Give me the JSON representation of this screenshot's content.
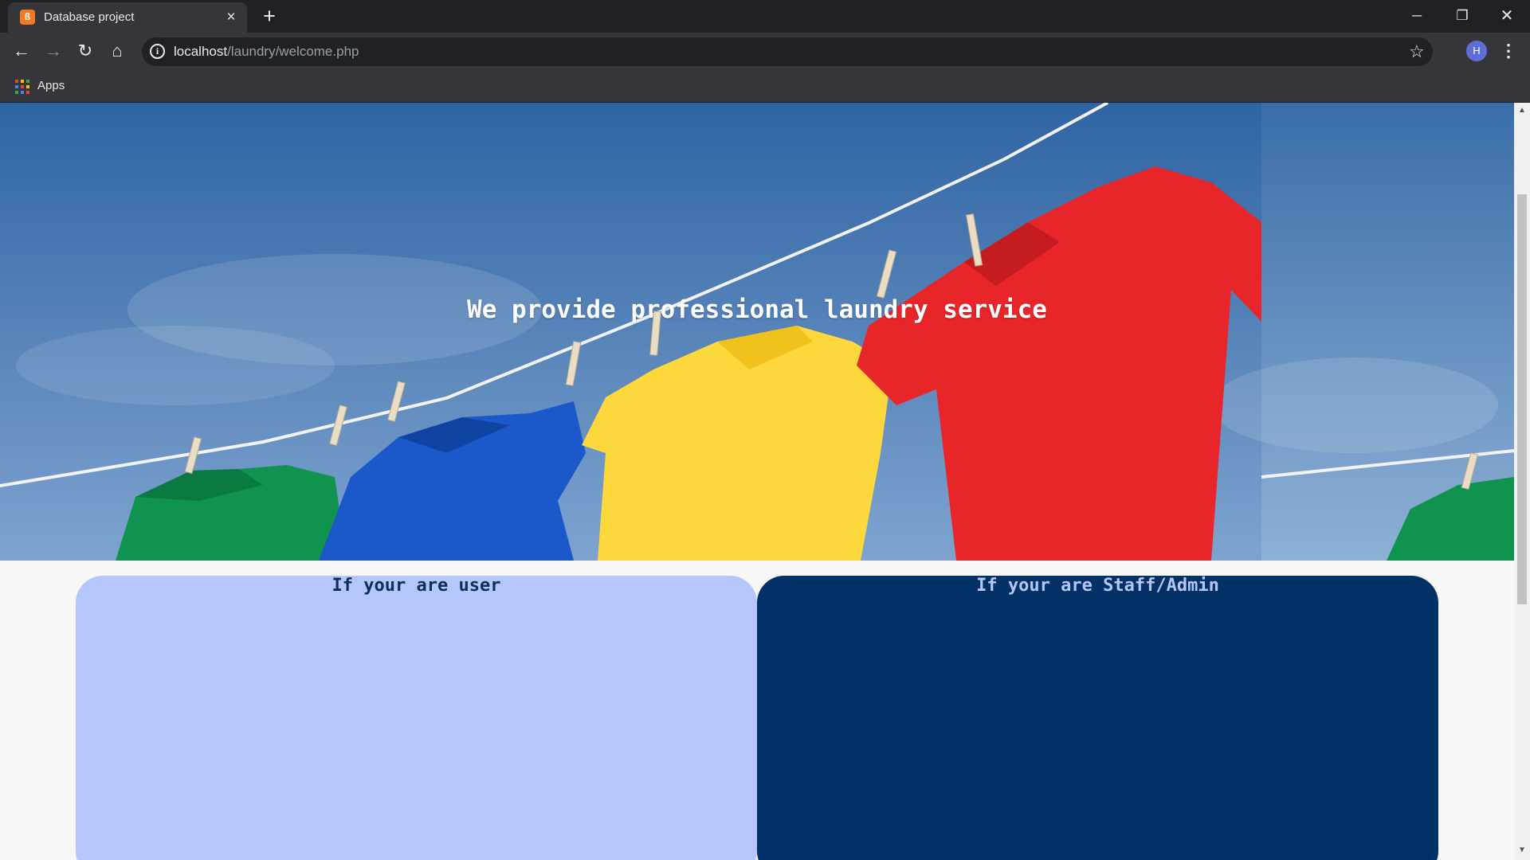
{
  "browser": {
    "tab": {
      "title": "Database project",
      "favicon": "xampp-logo-icon",
      "close": "×"
    },
    "new_tab": "+",
    "window": {
      "minimize": "─",
      "maximize": "❐",
      "close": "✕"
    },
    "address": {
      "host": "localhost",
      "path": "/laundry/welcome.php"
    },
    "profile_initial": "H",
    "bookmarks": {
      "apps_label": "Apps"
    },
    "accent_colors": {
      "tab_bg": "#35363a",
      "frame_bg": "#202124",
      "favicon": "#f27b22"
    }
  },
  "hero": {
    "headline": "We provide professional laundry service",
    "image": "laundry-clothesline-photo"
  },
  "cards": {
    "user": {
      "label": "If your are user",
      "color": "#b5c6fb"
    },
    "admin": {
      "label": "If your are Staff/Admin",
      "color": "#023168"
    }
  }
}
